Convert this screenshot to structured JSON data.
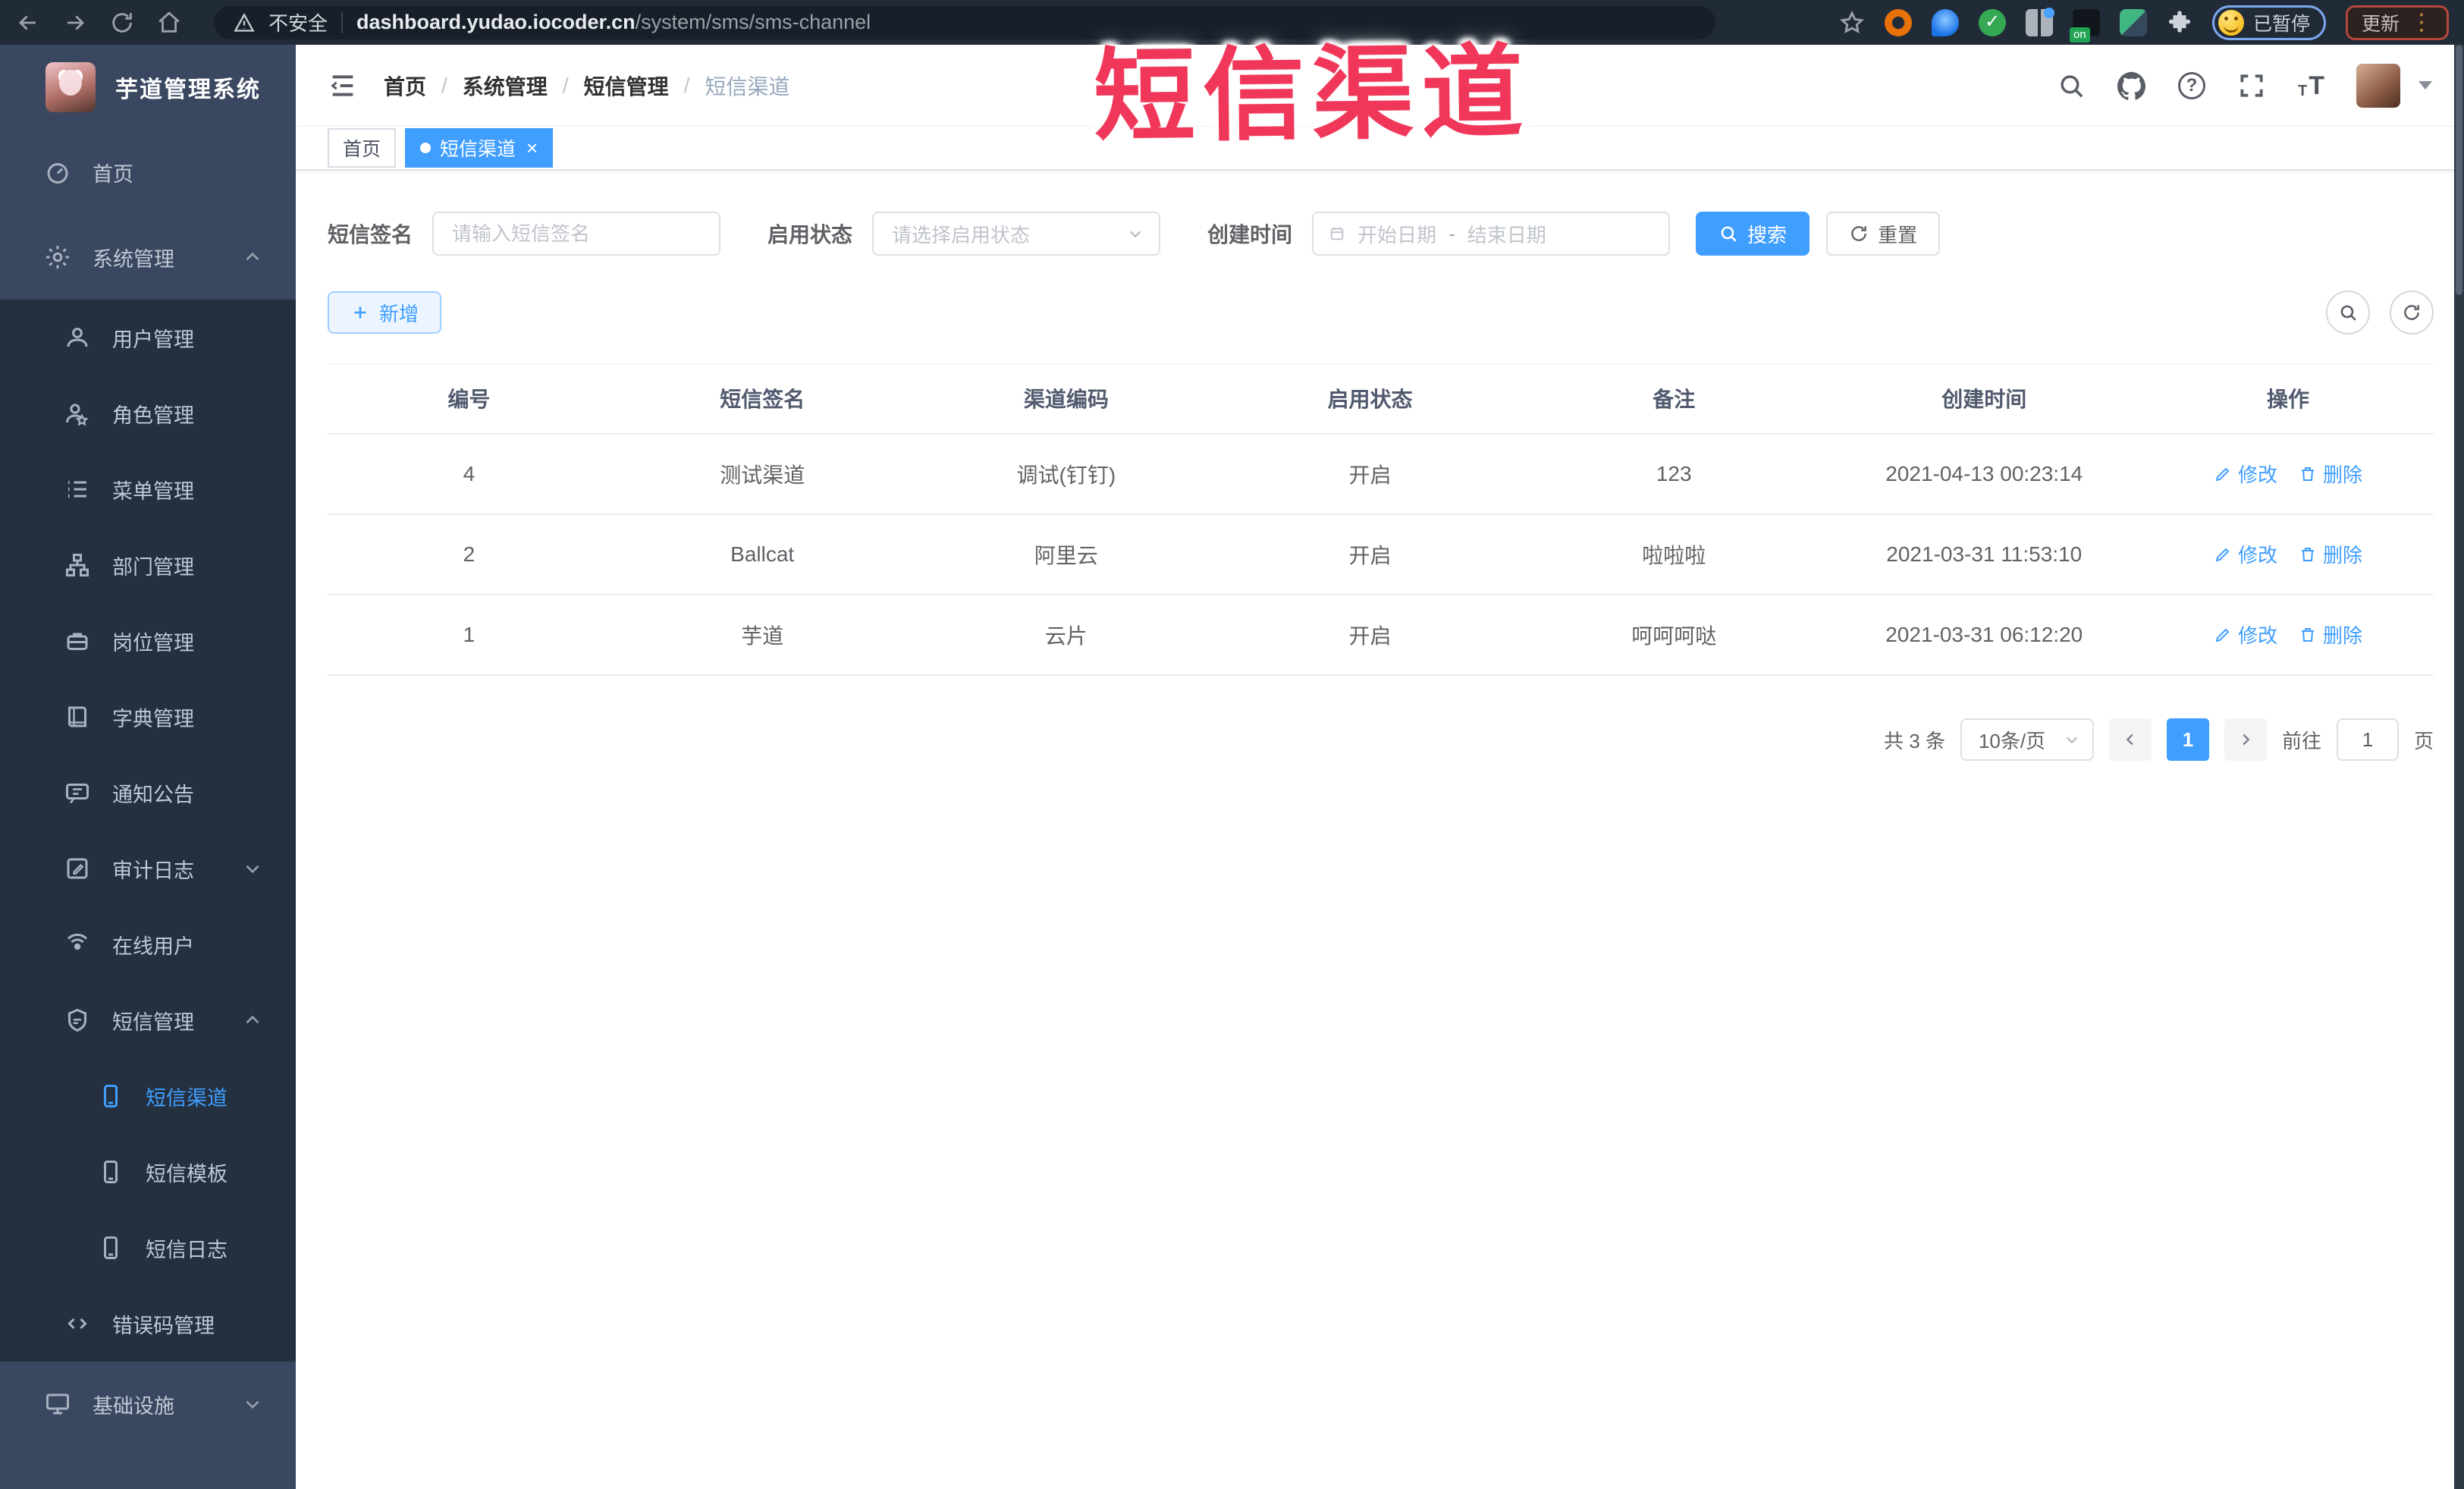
{
  "browser": {
    "security_label": "不安全",
    "url_host": "dashboard.yudao.iocoder.cn",
    "url_path": "/system/sms/sms-channel",
    "extension_badge": "on",
    "profile_status": "已暂停",
    "update_label": "更新"
  },
  "annotation": {
    "text": "短信渠道",
    "color": "#f0375a"
  },
  "sidebar": {
    "title": "芋道管理系统",
    "items": [
      {
        "label": "首页"
      },
      {
        "label": "系统管理"
      },
      {
        "label": "用户管理"
      },
      {
        "label": "角色管理"
      },
      {
        "label": "菜单管理"
      },
      {
        "label": "部门管理"
      },
      {
        "label": "岗位管理"
      },
      {
        "label": "字典管理"
      },
      {
        "label": "通知公告"
      },
      {
        "label": "审计日志"
      },
      {
        "label": "在线用户"
      },
      {
        "label": "短信管理"
      },
      {
        "label": "短信渠道",
        "active": true
      },
      {
        "label": "短信模板"
      },
      {
        "label": "短信日志"
      },
      {
        "label": "错误码管理"
      },
      {
        "label": "基础设施"
      }
    ]
  },
  "breadcrumb": {
    "items": [
      "首页",
      "系统管理",
      "短信管理",
      "短信渠道"
    ],
    "separator": "/"
  },
  "tags": {
    "items": [
      {
        "label": "首页"
      },
      {
        "label": "短信渠道",
        "active": true
      }
    ]
  },
  "filters": {
    "sign_label": "短信签名",
    "sign_placeholder": "请输入短信签名",
    "status_label": "启用状态",
    "status_placeholder": "请选择启用状态",
    "time_label": "创建时间",
    "start_placeholder": "开始日期",
    "range_separator": "-",
    "end_placeholder": "结束日期",
    "search_label": "搜索",
    "reset_label": "重置"
  },
  "toolbar": {
    "add_label": "新增"
  },
  "table": {
    "headers": [
      "编号",
      "短信签名",
      "渠道编码",
      "启用状态",
      "备注",
      "创建时间",
      "操作"
    ],
    "rows": [
      {
        "cells": [
          "4",
          "测试渠道",
          "调试(钉钉)",
          "开启",
          "123",
          "2021-04-13 00:23:14"
        ]
      },
      {
        "cells": [
          "2",
          "Ballcat",
          "阿里云",
          "开启",
          "啦啦啦",
          "2021-03-31 11:53:10"
        ]
      },
      {
        "cells": [
          "1",
          "芋道",
          "云片",
          "开启",
          "呵呵呵哒",
          "2021-03-31 06:12:20"
        ]
      }
    ],
    "edit_label": "修改",
    "delete_label": "删除"
  },
  "pagination": {
    "total": "共 3 条",
    "page_size": "10条/页",
    "current_page": "1",
    "goto_label": "前往",
    "goto_value": "1",
    "page_unit": "页"
  },
  "colors": {
    "accent": "#409EFF",
    "sidebar_bg": "#394760",
    "sidebar_sub_bg": "#24303f",
    "annotation": "#f0375a"
  }
}
